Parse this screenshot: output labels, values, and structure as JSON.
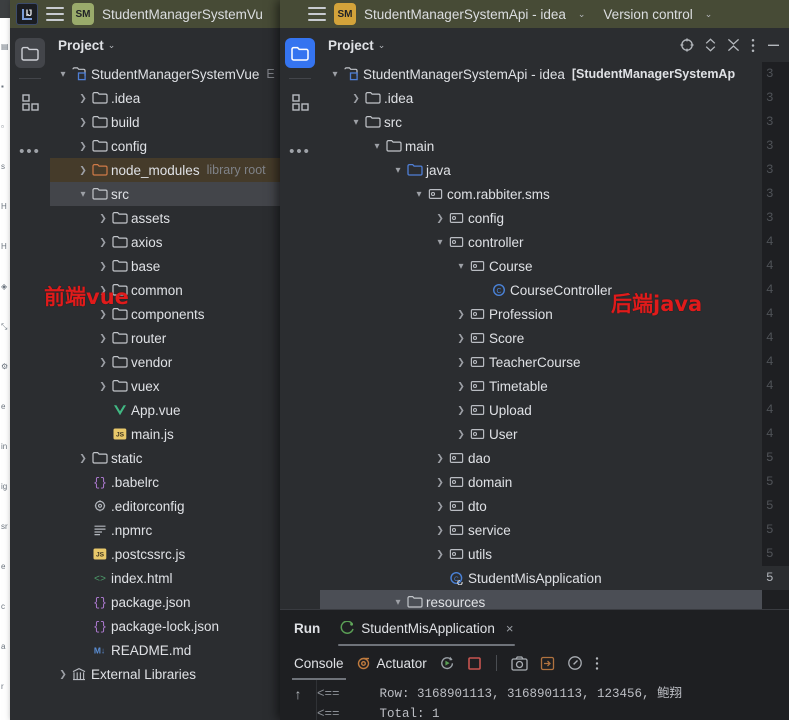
{
  "back_window": {
    "name": "background-editor-window",
    "gutter_glyphs": [
      "▤",
      "▪",
      "▫",
      "s",
      "H",
      "H",
      "◈",
      "⤡",
      "⚙",
      "e",
      "in",
      "ig",
      "sr",
      "e",
      "c",
      "a",
      "r"
    ]
  },
  "window_vue": {
    "titlebar": {
      "logo": "ij-logo",
      "menu_icon": "burger-menu-icon",
      "project_chip": "SM",
      "chip_color": "#9aab6b",
      "title": "StudentManagerSystemVu",
      "caret": "⌄"
    },
    "toolstrip": {
      "items": [
        {
          "name": "project-tool-button",
          "icon": "folder-icon",
          "selected": true
        },
        {
          "name": "structure-tool-button",
          "icon": "grid-squares-icon",
          "selected": false
        },
        {
          "name": "more-tool-windows-button",
          "icon": "ellipsis-icon",
          "selected": false
        }
      ]
    },
    "panel": {
      "title": "Project",
      "caret": "⌄"
    },
    "tree": [
      {
        "label": "StudentManagerSystemVue",
        "sub": "E",
        "icon": "module-icon",
        "arrow": "⌄",
        "indent": 0,
        "bold": false,
        "state": "none"
      },
      {
        "label": ".idea",
        "sub": "",
        "icon": "folder-icon",
        "arrow": "›",
        "indent": 1,
        "bold": false,
        "state": "none"
      },
      {
        "label": "build",
        "sub": "",
        "icon": "folder-icon",
        "arrow": "›",
        "indent": 1,
        "bold": false,
        "state": "none"
      },
      {
        "label": "config",
        "sub": "",
        "icon": "folder-icon",
        "arrow": "›",
        "indent": 1,
        "bold": false,
        "state": "none"
      },
      {
        "label": "node_modules",
        "sub": "library root",
        "icon": "folder-orange-icon",
        "arrow": "›",
        "indent": 1,
        "bold": false,
        "state": "amber"
      },
      {
        "label": "src",
        "sub": "",
        "icon": "folder-icon",
        "arrow": "⌄",
        "indent": 1,
        "bold": false,
        "state": "grey"
      },
      {
        "label": "assets",
        "sub": "",
        "icon": "folder-icon",
        "arrow": "›",
        "indent": 2,
        "bold": false,
        "state": "none"
      },
      {
        "label": "axios",
        "sub": "",
        "icon": "folder-icon",
        "arrow": "›",
        "indent": 2,
        "bold": false,
        "state": "none"
      },
      {
        "label": "base",
        "sub": "",
        "icon": "folder-icon",
        "arrow": "›",
        "indent": 2,
        "bold": false,
        "state": "none"
      },
      {
        "label": "common",
        "sub": "",
        "icon": "folder-icon",
        "arrow": "›",
        "indent": 2,
        "bold": false,
        "state": "none"
      },
      {
        "label": "components",
        "sub": "",
        "icon": "folder-icon",
        "arrow": "›",
        "indent": 2,
        "bold": false,
        "state": "none"
      },
      {
        "label": "router",
        "sub": "",
        "icon": "folder-icon",
        "arrow": "›",
        "indent": 2,
        "bold": false,
        "state": "none"
      },
      {
        "label": "vendor",
        "sub": "",
        "icon": "folder-icon",
        "arrow": "›",
        "indent": 2,
        "bold": false,
        "state": "none"
      },
      {
        "label": "vuex",
        "sub": "",
        "icon": "folder-icon",
        "arrow": "›",
        "indent": 2,
        "bold": false,
        "state": "none"
      },
      {
        "label": "App.vue",
        "sub": "",
        "icon": "vue-file-icon",
        "arrow": "",
        "indent": 2,
        "bold": false,
        "state": "none"
      },
      {
        "label": "main.js",
        "sub": "",
        "icon": "js-file-icon",
        "arrow": "",
        "indent": 2,
        "bold": false,
        "state": "none"
      },
      {
        "label": "static",
        "sub": "",
        "icon": "folder-icon",
        "arrow": "›",
        "indent": 1,
        "bold": false,
        "state": "none"
      },
      {
        "label": ".babelrc",
        "sub": "",
        "icon": "json-file-icon",
        "arrow": "",
        "indent": 1,
        "bold": false,
        "state": "none"
      },
      {
        "label": ".editorconfig",
        "sub": "",
        "icon": "config-file-icon",
        "arrow": "",
        "indent": 1,
        "bold": false,
        "state": "none"
      },
      {
        "label": ".npmrc",
        "sub": "",
        "icon": "text-file-icon",
        "arrow": "",
        "indent": 1,
        "bold": false,
        "state": "none"
      },
      {
        "label": ".postcssrc.js",
        "sub": "",
        "icon": "js-file-icon",
        "arrow": "",
        "indent": 1,
        "bold": false,
        "state": "none"
      },
      {
        "label": "index.html",
        "sub": "",
        "icon": "html-file-icon",
        "arrow": "",
        "indent": 1,
        "bold": false,
        "state": "none"
      },
      {
        "label": "package.json",
        "sub": "",
        "icon": "json-file-icon",
        "arrow": "",
        "indent": 1,
        "bold": false,
        "state": "none"
      },
      {
        "label": "package-lock.json",
        "sub": "",
        "icon": "json-file-icon",
        "arrow": "",
        "indent": 1,
        "bold": false,
        "state": "none"
      },
      {
        "label": "README.md",
        "sub": "",
        "icon": "markdown-file-icon",
        "arrow": "",
        "indent": 1,
        "bold": false,
        "state": "none"
      },
      {
        "label": "External Libraries",
        "sub": "",
        "icon": "libraries-icon",
        "arrow": "›",
        "indent": 0,
        "bold": false,
        "state": "none"
      }
    ],
    "annotation": "前端vue",
    "annotation_color": "#e01b1b"
  },
  "window_api": {
    "titlebar": {
      "menu_icon": "burger-menu-icon",
      "project_chip": "SM",
      "chip_color": "#d3a33a",
      "title": "StudentManagerSystemApi - idea",
      "caret": "⌄",
      "vcs_label": "Version control",
      "vcs_caret": "⌄"
    },
    "toolstrip": {
      "items": [
        {
          "name": "project-tool-button",
          "icon": "folder-icon",
          "selected": true
        },
        {
          "name": "structure-tool-button",
          "icon": "grid-squares-icon",
          "selected": false
        },
        {
          "name": "more-tool-windows-button",
          "icon": "ellipsis-icon",
          "selected": false
        }
      ],
      "bottom_icon": "terminal-icon"
    },
    "panel": {
      "title": "Project",
      "caret": "⌄",
      "actions": [
        {
          "name": "select-opened-file-button",
          "icon": "target-icon"
        },
        {
          "name": "expand-collapse-button",
          "icon": "chevrons-updown-icon"
        },
        {
          "name": "collapse-all-button",
          "icon": "collapse-all-icon"
        },
        {
          "name": "options-menu-button",
          "icon": "vertical-ellipsis-icon"
        },
        {
          "name": "hide-panel-button",
          "icon": "minimize-icon"
        }
      ]
    },
    "tree": [
      {
        "label": "StudentManagerSystemApi - idea",
        "sub": "[StudentManagerSystemAp",
        "icon": "module-icon",
        "arrow": "⌄",
        "indent": 0,
        "bold_sub": true,
        "state": "none"
      },
      {
        "label": ".idea",
        "sub": "",
        "icon": "folder-icon",
        "arrow": "›",
        "indent": 1,
        "state": "none"
      },
      {
        "label": "src",
        "sub": "",
        "icon": "folder-icon",
        "arrow": "⌄",
        "indent": 1,
        "state": "none"
      },
      {
        "label": "main",
        "sub": "",
        "icon": "folder-icon",
        "arrow": "⌄",
        "indent": 2,
        "state": "none"
      },
      {
        "label": "java",
        "sub": "",
        "icon": "folder-blue-icon",
        "arrow": "⌄",
        "indent": 3,
        "state": "none"
      },
      {
        "label": "com.rabbiter.sms",
        "sub": "",
        "icon": "package-icon",
        "arrow": "⌄",
        "indent": 4,
        "state": "none"
      },
      {
        "label": "config",
        "sub": "",
        "icon": "package-icon",
        "arrow": "›",
        "indent": 5,
        "state": "none"
      },
      {
        "label": "controller",
        "sub": "",
        "icon": "package-icon",
        "arrow": "⌄",
        "indent": 5,
        "state": "none"
      },
      {
        "label": "Course",
        "sub": "",
        "icon": "package-icon",
        "arrow": "⌄",
        "indent": 6,
        "state": "none"
      },
      {
        "label": "CourseController",
        "sub": "",
        "icon": "java-class-icon",
        "arrow": "",
        "indent": 7,
        "state": "none"
      },
      {
        "label": "Profession",
        "sub": "",
        "icon": "package-icon",
        "arrow": "›",
        "indent": 6,
        "state": "none"
      },
      {
        "label": "Score",
        "sub": "",
        "icon": "package-icon",
        "arrow": "›",
        "indent": 6,
        "state": "none"
      },
      {
        "label": "TeacherCourse",
        "sub": "",
        "icon": "package-icon",
        "arrow": "›",
        "indent": 6,
        "state": "none"
      },
      {
        "label": "Timetable",
        "sub": "",
        "icon": "package-icon",
        "arrow": "›",
        "indent": 6,
        "state": "none"
      },
      {
        "label": "Upload",
        "sub": "",
        "icon": "package-icon",
        "arrow": "›",
        "indent": 6,
        "state": "none"
      },
      {
        "label": "User",
        "sub": "",
        "icon": "package-icon",
        "arrow": "›",
        "indent": 6,
        "state": "none"
      },
      {
        "label": "dao",
        "sub": "",
        "icon": "package-icon",
        "arrow": "›",
        "indent": 5,
        "state": "none"
      },
      {
        "label": "domain",
        "sub": "",
        "icon": "package-icon",
        "arrow": "›",
        "indent": 5,
        "state": "none"
      },
      {
        "label": "dto",
        "sub": "",
        "icon": "package-icon",
        "arrow": "›",
        "indent": 5,
        "state": "none"
      },
      {
        "label": "service",
        "sub": "",
        "icon": "package-icon",
        "arrow": "›",
        "indent": 5,
        "state": "none"
      },
      {
        "label": "utils",
        "sub": "",
        "icon": "package-icon",
        "arrow": "›",
        "indent": 5,
        "state": "none"
      },
      {
        "label": "StudentMisApplication",
        "sub": "",
        "icon": "spring-class-icon",
        "arrow": "",
        "indent": 5,
        "state": "none"
      },
      {
        "label": "resources",
        "sub": "",
        "icon": "folder-icon",
        "arrow": "⌄",
        "indent": 3,
        "state": "light"
      }
    ],
    "annotation": "后端java",
    "annotation_color": "#e01b1b"
  },
  "editor_gutter": {
    "name": "editor-line-numbers",
    "lines": [
      "3",
      "3",
      "3",
      "3",
      "3",
      "3",
      "3",
      "4",
      "4",
      "4",
      "4",
      "4",
      "4",
      "4",
      "4",
      "4",
      "5",
      "5",
      "5",
      "5",
      "5",
      "5"
    ],
    "current_line_index": 21
  },
  "run_panel": {
    "title": "Run",
    "tab": {
      "label": "StudentMisApplication",
      "icon": "spring-run-icon",
      "close": "×"
    },
    "toolbar": {
      "console_label": "Console",
      "actuator_label": "Actuator",
      "buttons": [
        {
          "name": "rerun-button",
          "icon": "rerun-icon"
        },
        {
          "name": "stop-button",
          "icon": "stop-square-icon",
          "color": "#c75450"
        },
        {
          "name": "screenshot-button",
          "icon": "camera-icon"
        },
        {
          "name": "export-button",
          "icon": "export-icon"
        },
        {
          "name": "profiler-button",
          "icon": "gauge-icon"
        },
        {
          "name": "more-options-button",
          "icon": "vertical-ellipsis-icon"
        }
      ]
    },
    "console": {
      "scroll_icon": "up-arrow-icon",
      "lines": [
        {
          "prefix": "<==",
          "text": "Row: 3168901113, 3168901113, 123456, 鲍翔"
        },
        {
          "prefix": "<==",
          "text": "Total: 1"
        }
      ]
    }
  }
}
